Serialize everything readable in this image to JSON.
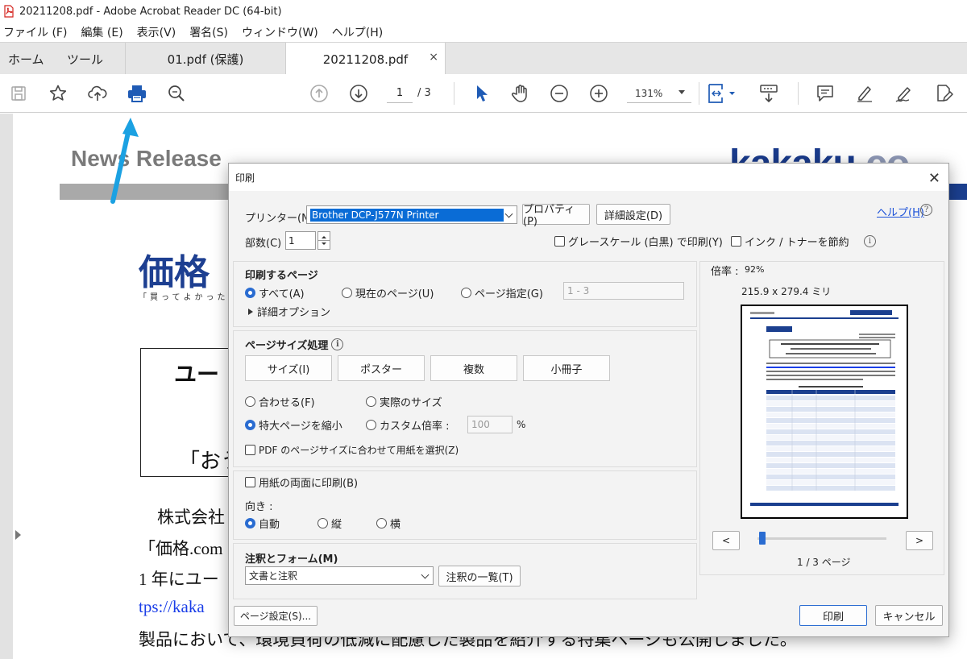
{
  "window": {
    "title": "20211208.pdf - Adobe Acrobat Reader DC (64-bit)"
  },
  "menu": [
    "ファイル (F)",
    "編集 (E)",
    "表示(V)",
    "署名(S)",
    "ウィンドウ(W)",
    "ヘルプ(H)"
  ],
  "tabs": {
    "home": "ホーム",
    "tools": "ツール",
    "doc1": "01.pdf (保護)",
    "doc2": "20211208.pdf",
    "close": "×"
  },
  "toolbar": {
    "page_current": "1",
    "page_total": "/ 3",
    "zoom": "131%"
  },
  "document": {
    "news_release": "News Release",
    "logo_main": "kakaku",
    "logo_domain": ".co",
    "logo_jp": "価格",
    "tagline": "「買ってよかった」",
    "headline_1": "ユー",
    "headline_2": "「おう",
    "para_1": "株式会社",
    "para_2": "「価格.com",
    "para_3": "1 年にユー",
    "para_4": "tps://kaka",
    "para_5": "製品において、環境負荷の低減に配慮した製品を紹介する特集ページも公開しました。"
  },
  "print_dialog": {
    "title": "印刷",
    "printer_label": "プリンター(N) :",
    "printer_value": "Brother DCP-J577N Printer",
    "properties_button": "プロパティ(P)",
    "advanced_button": "詳細設定(D)",
    "help_link": "ヘルプ(H)",
    "copies_label": "部数(C) :",
    "copies_value": "1",
    "grayscale_label": "グレースケール (白黒) で印刷(Y)",
    "save_ink_label": "インク / トナーを節約",
    "pages_section": "印刷するページ",
    "pages_all": "すべて(A)",
    "pages_current": "現在のページ(U)",
    "pages_range": "ページ指定(G)",
    "pages_range_value": "1 - 3",
    "more_options": "詳細オプション",
    "sizing_section": "ページサイズ処理",
    "size_buttons": [
      "サイズ(I)",
      "ポスター",
      "複数",
      "小冊子"
    ],
    "fit": "合わせる(F)",
    "actual_size": "実際のサイズ",
    "shrink_oversized": "特大ページを縮小",
    "custom_scale": "カスタム倍率 :",
    "custom_scale_value": "100",
    "percent": "%",
    "choose_paper_by_pdf": "PDF のページサイズに合わせて用紙を選択(Z)",
    "duplex": "用紙の両面に印刷(B)",
    "orientation_label": "向き :",
    "orient_auto": "自動",
    "orient_portrait": "縦",
    "orient_landscape": "横",
    "comments_section": "注釈とフォーム(M)",
    "comments_value": "文書と注釈",
    "summarize_button": "注釈の一覧(T)",
    "scale_label": "倍率 :",
    "scale_value": "92%",
    "paper_size": "215.9 x 279.4 ミリ",
    "prev_button": "<",
    "next_button": ">",
    "page_indicator": "1 / 3 ページ",
    "page_setup_button": "ページ設定(S)...",
    "print_button": "印刷",
    "cancel_button": "キャンセル"
  },
  "colors": {
    "accent": "#2a6cd1",
    "selection": "#0a6cd6",
    "link": "#1a3ee8",
    "brand_blue": "#1b3f8f",
    "arrow": "#1ba1e2"
  }
}
